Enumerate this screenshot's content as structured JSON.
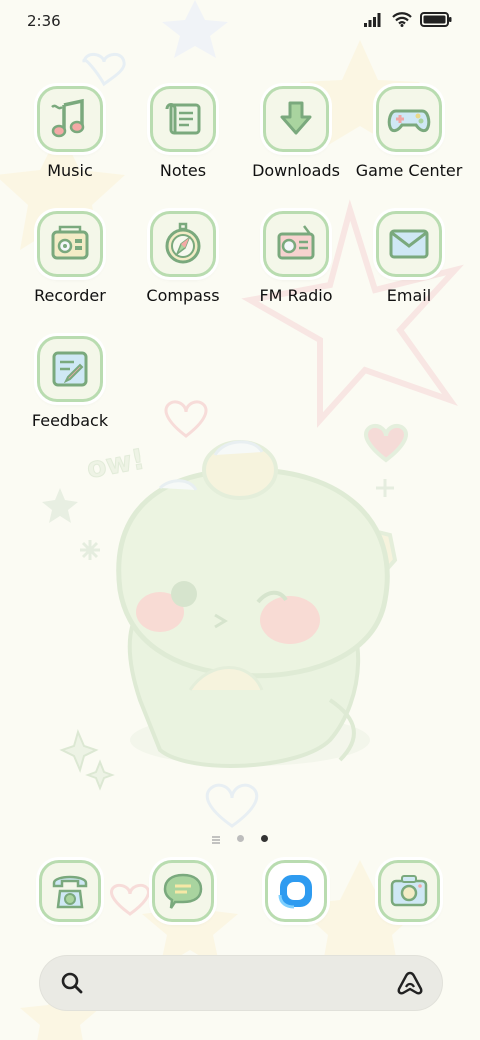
{
  "status_bar": {
    "time": "2:36",
    "icons": [
      "cellular-signal-icon",
      "wifi-icon",
      "battery-icon"
    ]
  },
  "apps": [
    {
      "label": "Music",
      "icon": "music-note-icon"
    },
    {
      "label": "Notes",
      "icon": "notes-scroll-icon"
    },
    {
      "label": "Downloads",
      "icon": "download-arrow-icon"
    },
    {
      "label": "Game Center",
      "icon": "gamepad-icon"
    },
    {
      "label": "Recorder",
      "icon": "recorder-icon"
    },
    {
      "label": "Compass",
      "icon": "compass-icon"
    },
    {
      "label": "FM Radio",
      "icon": "radio-icon"
    },
    {
      "label": "Email",
      "icon": "envelope-icon"
    },
    {
      "label": "Feedback",
      "icon": "feedback-icon"
    }
  ],
  "page_indicator": {
    "pages": 2,
    "current": 2
  },
  "dock": [
    {
      "icon": "phone-icon"
    },
    {
      "icon": "messages-icon"
    },
    {
      "icon": "browser-icon"
    },
    {
      "icon": "camera-icon"
    }
  ],
  "search_bar": {
    "icons": [
      "search-icon",
      "assistant-icon"
    ]
  },
  "wallpaper": {
    "text": "ow!"
  },
  "colors": {
    "tile_border": "#b9dcb0",
    "tile_fill": "#f4f7e9",
    "dino": "#e3f0d6",
    "accent_blue": "#cfe8f5",
    "accent_pink": "#f6b6b6"
  }
}
